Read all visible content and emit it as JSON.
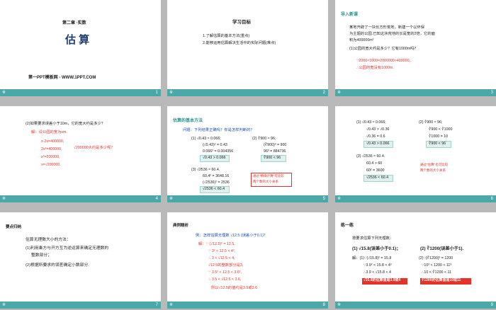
{
  "slides": [
    {
      "num": "1",
      "star": "※",
      "chapter": "第二章 ·实数",
      "title": "估 算",
      "footer": "第一PPT模板网 - WWW.1PPT.COM"
    },
    {
      "num": "2",
      "star": "※",
      "head": "学习目标",
      "lines": [
        "1.了解估算的基本方法(重点)",
        "2.能够运用估算解决生活中的实际问题(难点)"
      ]
    },
    {
      "num": "3",
      "star": "※",
      "head": "导入新课",
      "lines": [
        "某地开辟了一块长方形荒地，新建一个以环保",
        "为主题的公园.已知这块荒地的长是宽的2倍，它的面",
        "积为400000m²",
        "(1)公园的宽大约是多少？它有1000m吗？",
        "∵2000×1000=2000000>400000，",
        "∴公园的宽没有1000m."
      ]
    },
    {
      "num": "4",
      "star": "※",
      "q": "(2)如果要求误差小于10m，它的宽大约是多少？",
      "sol": "解：设公园的宽为xm.",
      "steps": [
        "x·2x=400000,",
        "2x²=400000,",
        "x²=200000,",
        "x=√200000."
      ],
      "note": "√200000大约是多少呢？"
    },
    {
      "num": "5",
      "star": "※",
      "head": "估算的基本方法",
      "q": "问题：下列结果正确吗？你是怎样判断的？",
      "left1": [
        "(1) √0.43 ≈ 0.066;",
        "(√0.43)² = 0.43",
        "0.066² = 0.004356",
        "√0.43 > 0.066"
      ],
      "right1": [
        "(2) ∛900 ≈ 96;",
        "(∛900)³ = 900",
        "96³ = 884736",
        "∛900 < 96"
      ],
      "left2": [
        "(3) √2536 ≈ 60.4.",
        "60.4² = 3648.16",
        "(√2536)² = 2536",
        "√2536 < 60.4"
      ],
      "tip": [
        "通过\"精确计算\"可比较",
        "两个数的大小关系"
      ]
    },
    {
      "num": "6",
      "star": "※",
      "l1": [
        "(1) √0.43 ≈ 0.066;",
        "√0.43 > √0.36",
        "√0.36 = 0.6",
        "√0.43 > 0.066"
      ],
      "r1": [
        "(2) ∛900 ≈ 96;",
        "∛900 < ∛1000",
        "∛1000 = 10",
        "∛900 < 96"
      ],
      "l2": [
        "(3) √2536 ≈ 60.4.",
        "60.4 > 60",
        "60² = 3600",
        "√2536 < 60.4"
      ],
      "tip": [
        "通过\"估算\"也可比较",
        "两个数的大小关系"
      ]
    },
    {
      "num": "7",
      "star": "※",
      "head": "要点归纳",
      "lines": [
        "估算无理数大小的方法：",
        "(1)利用乘方与开方互为逆运算来确定无理数的",
        "整数部分；",
        "(2)根据所要求的误差确定小数部分."
      ]
    },
    {
      "num": "8",
      "star": "※",
      "head": "典例精析",
      "q": "例：怎样估算无理数 √12.5 (误差小于0.1)？",
      "steps": [
        "解：∵ (√12.5)² = 12.5,",
        "∵ 3² < 12.5 < 4²,",
        "∴ 3 < √12.5 < 4,",
        "√12.5的整数部分是3,",
        "∵ 3.5² < 12.5 < 3.6²,",
        "∴ 3.5 < √12.5 < 3.6,",
        "所以√12.5的值约是3.5或3.6"
      ]
    },
    {
      "num": "9",
      "star": "※",
      "head": "练一练",
      "q": "按要求估算下列无理数：",
      "items": [
        "(1) √15.8(误差小于0.1)；",
        "(2) ∛1200(误差小于1)."
      ],
      "s1": [
        "解：(1)∵(√15.8)² = 15.8",
        "∵3.9² < 15.8 < 4²",
        "∴3.9 < √15.8 < 4"
      ],
      "s2": [
        "(2)∵(∛1200)³ = 1200",
        "∵10³ < 1200 < 11³",
        "∴10 < ∛1200 < 11"
      ],
      "ans1": "√15.8的估算值是3.9或4",
      "ans2": "∛1200的估算值是10或11"
    }
  ]
}
